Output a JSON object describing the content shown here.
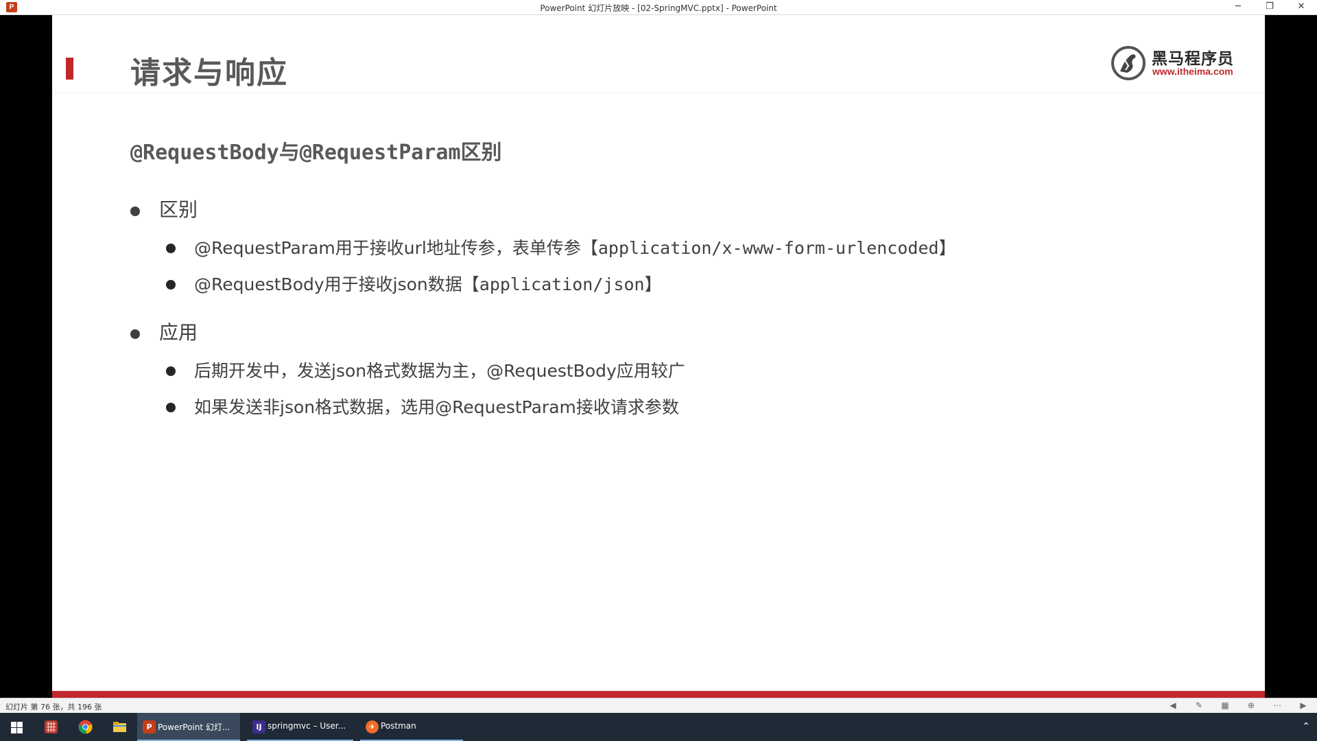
{
  "window": {
    "app_icon_letter": "P",
    "title": "PowerPoint 幻灯片放映 - [02-SpringMVC.pptx] - PowerPoint",
    "minimize": "─",
    "maximize": "❐",
    "close": "✕"
  },
  "slide": {
    "title": "请求与响应",
    "logo": {
      "name_cn": "黑马程序员",
      "url": "www.itheima.com"
    },
    "subtitle": {
      "part1": "@RequestBody",
      "part2": "与",
      "part3": "@RequestParam",
      "part4": "区别"
    },
    "sections": [
      {
        "heading": "区别",
        "items": [
          {
            "lead": "@RequestParam用于接收url地址传参，表单传参【",
            "code": "application/x-www-form-urlencoded",
            "tail": "】"
          },
          {
            "lead": "@RequestBody用于接收json数据【",
            "code": "application/json",
            "tail": "】"
          }
        ]
      },
      {
        "heading": "应用",
        "items": [
          {
            "text": "后期开发中，发送json格式数据为主，@RequestBody应用较广"
          },
          {
            "text": "如果发送非json格式数据，选用@RequestParam接收请求参数"
          }
        ]
      }
    ],
    "accent_color": "#c0282c"
  },
  "statusbar": {
    "slide_counter": "幻灯片 第 76 张，共 196 张"
  },
  "taskbar": {
    "apps": [
      {
        "label": "PowerPoint 幻灯...",
        "icon": "powerpoint-icon"
      },
      {
        "label": "springmvc – User...",
        "icon": "intellij-icon"
      },
      {
        "label": "Postman",
        "icon": "postman-icon"
      }
    ]
  }
}
